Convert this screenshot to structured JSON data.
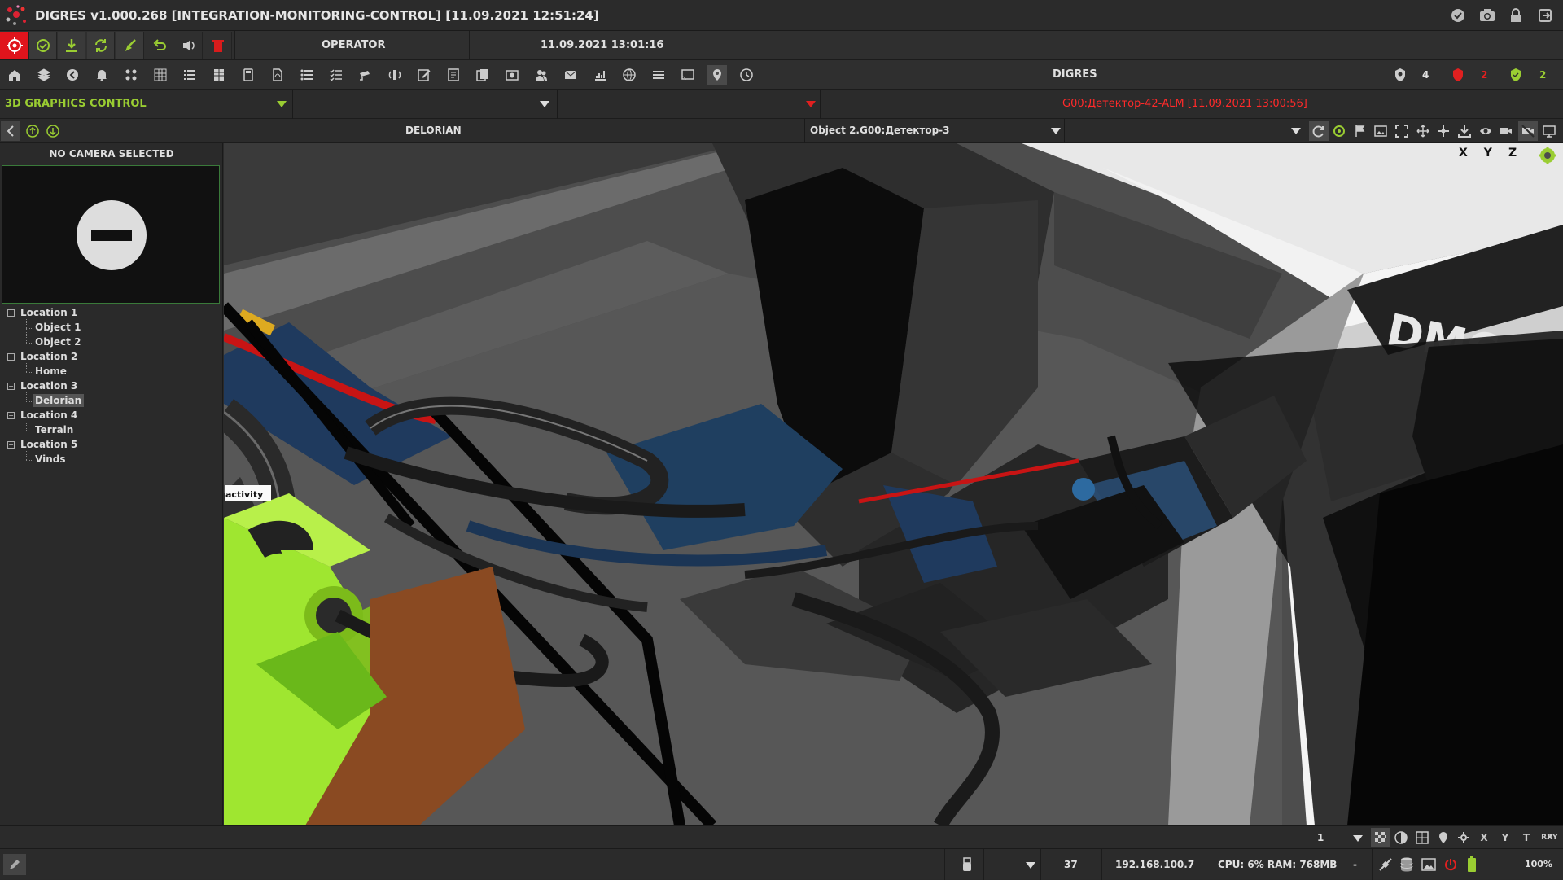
{
  "window": {
    "title": "DIGRES v1.000.268 [INTEGRATION-MONITORING-CONTROL] [11.09.2021 12:51:24]"
  },
  "header": {
    "role": "OPERATOR",
    "datetime": "11.09.2021 13:01:16",
    "system": "DIGRES",
    "counters": {
      "shield": "4",
      "alarm": "2",
      "ok": "2"
    }
  },
  "mode_bar": {
    "mode_select": "3D GRAPHICS CONTROL",
    "second_select": "",
    "third_select": "",
    "alarm_message": "G00:Детектор-42-ALM [11.09.2021 13:00:56]"
  },
  "view_bar": {
    "scene_name": "DELORIAN",
    "object_select": "Object 2.G00:Детектор-3",
    "empty_select": ""
  },
  "camera": {
    "header": "NO CAMERA SELECTED"
  },
  "tree": [
    {
      "label": "Location 1",
      "children": [
        "Object 1",
        "Object 2"
      ]
    },
    {
      "label": "Location 2",
      "children": [
        "Home"
      ]
    },
    {
      "label": "Location 3",
      "children": [
        "Delorian"
      ]
    },
    {
      "label": "Location 4",
      "children": [
        "Terrain"
      ]
    },
    {
      "label": "Location 5",
      "children": [
        "Vinds"
      ]
    }
  ],
  "viewport": {
    "axes": [
      "X",
      "Y",
      "Z"
    ],
    "tooltip": "activity",
    "logo_text": "DMC"
  },
  "bottom_bar": {
    "page_select": "1",
    "view_buttons": [
      "X",
      "Y",
      "T",
      "RX",
      "RY"
    ]
  },
  "status": {
    "select": "",
    "count": "37",
    "ip": "192.168.100.7",
    "resources": "CPU: 6% RAM: 768MB",
    "dash": "-",
    "zoom": "100%"
  },
  "colors": {
    "accent_green": "#9acd32",
    "alarm_red": "#e02020",
    "alarm_text": "#ff2a2a"
  }
}
